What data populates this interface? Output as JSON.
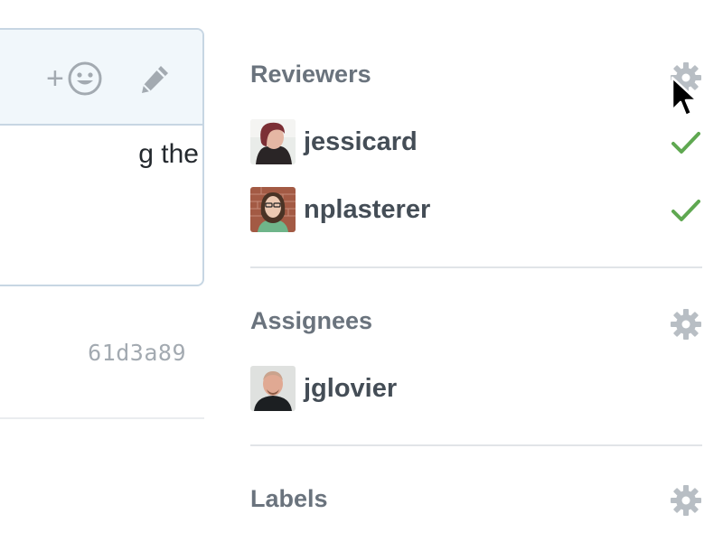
{
  "comment": {
    "reaction_plus": "+",
    "body_text": "g the",
    "commit_sha": "61d3a89"
  },
  "sidebar": {
    "reviewers": {
      "title": "Reviewers",
      "people": [
        {
          "login": "jessicard",
          "status": "approved"
        },
        {
          "login": "nplasterer",
          "status": "approved"
        }
      ]
    },
    "assignees": {
      "title": "Assignees",
      "people": [
        {
          "login": "jglovier"
        }
      ]
    },
    "labels": {
      "title": "Labels"
    }
  },
  "icons": {
    "reaction": "smiley-icon",
    "edit": "pencil-icon",
    "gear": "gear-icon",
    "check": "check-icon",
    "cursor": "mouse-pointer-icon"
  },
  "colors": {
    "accent_check": "#5fa851",
    "muted_text": "#6a737d",
    "name_text": "#444d56",
    "border": "#c7d6e3",
    "header_bg": "#f1f7fb"
  }
}
